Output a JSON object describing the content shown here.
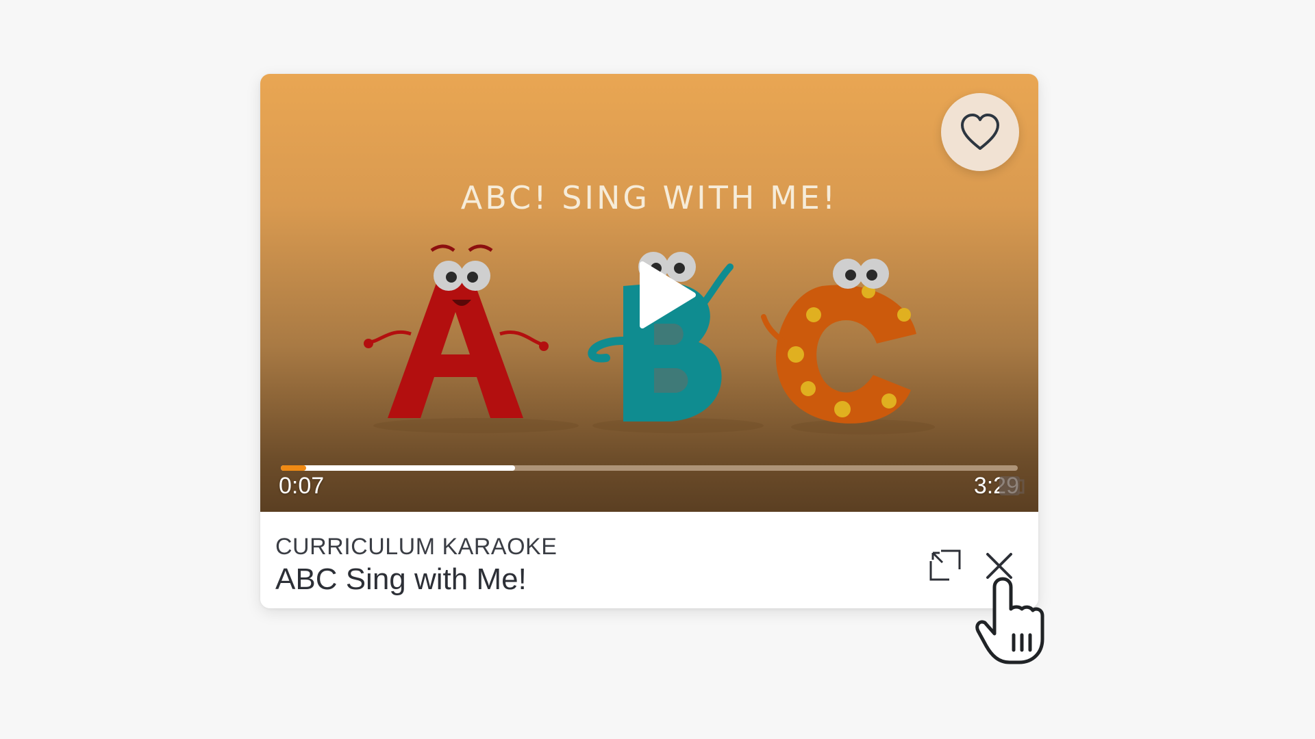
{
  "card": {
    "eyebrow": "CURRICULUM KARAOKE",
    "title": "ABC Sing with Me!"
  },
  "video": {
    "overlay_title": "ABC! SING WITH ME!",
    "time_elapsed": "0:07",
    "time_total": "3:29",
    "played_fraction": 0.034,
    "buffered_fraction": 0.318,
    "accent_color": "#f08a14"
  },
  "icons": {
    "favorite": "heart-icon",
    "play": "play-icon",
    "expand": "expand-icon",
    "close": "close-icon",
    "cursor": "hand-pointer-cursor"
  }
}
